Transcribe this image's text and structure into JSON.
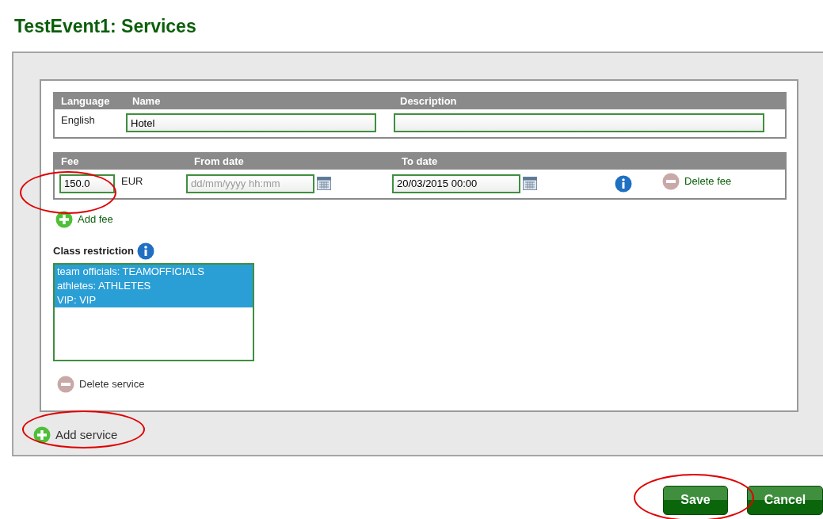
{
  "title": "TestEvent1: Services",
  "service": {
    "columns": [
      "Language",
      "Name",
      "Description"
    ],
    "language": "English",
    "name": "Hotel",
    "fee_columns": [
      "Fee",
      "From date",
      "To date"
    ],
    "fees": [
      {
        "amount": "150.0",
        "currency": "EUR",
        "from_placeholder": "dd/mm/yyyy hh:mm",
        "to_date": "20/03/2015 00:00",
        "delete_label": "Delete fee"
      }
    ],
    "add_fee": "Add fee",
    "class_restriction_label": "Class restriction",
    "classes": [
      {
        "label": "team officials: TEAMOFFICIALS",
        "selected": true
      },
      {
        "label": "athletes: ATHLETES",
        "selected": true
      },
      {
        "label": "VIP: VIP",
        "selected": true
      }
    ],
    "delete_service": "Delete service"
  },
  "add_service": "Add service",
  "buttons": [
    "Save",
    "Cancel"
  ]
}
